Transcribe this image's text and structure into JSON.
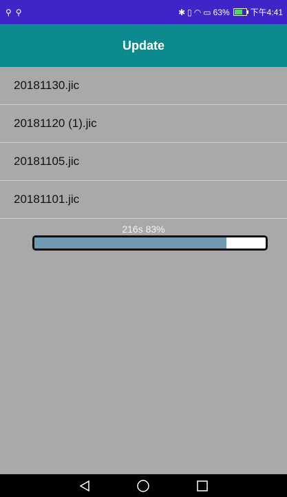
{
  "status_bar": {
    "left_icons": [
      "usb-icon",
      "usb-icon"
    ],
    "battery_percent": "63%",
    "time": "下午4:41"
  },
  "app_bar": {
    "title": "Update"
  },
  "files": [
    {
      "name": "20181130.jic"
    },
    {
      "name": "20181120 (1).jic"
    },
    {
      "name": "20181105.jic"
    },
    {
      "name": "20181101.jic"
    }
  ],
  "progress": {
    "label": "216s 83%",
    "fraction": 0.83
  },
  "nav_bar": {
    "buttons": [
      "back-icon",
      "home-icon",
      "recents-icon"
    ]
  },
  "colors": {
    "status_bar": "#3f24c8",
    "app_bar": "#0c8a8f",
    "background": "#a9a9a9",
    "progress_fill": "#6f9ab1"
  }
}
